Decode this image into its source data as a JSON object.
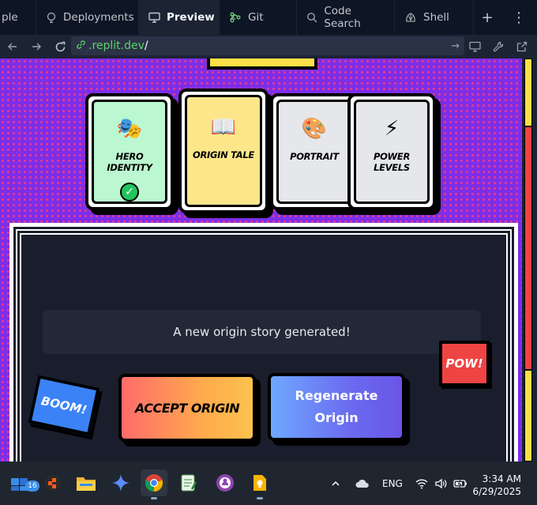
{
  "tabs": [
    {
      "label": "ple",
      "icon": "none"
    },
    {
      "label": "Deployments",
      "icon": "deploy-icon"
    },
    {
      "label": "Preview",
      "icon": "monitor-icon",
      "active": true
    },
    {
      "label": "Git",
      "icon": "git-icon"
    },
    {
      "label": "Code Search",
      "icon": "search-icon"
    },
    {
      "label": "Shell",
      "icon": "shell-icon"
    }
  ],
  "url": {
    "prefix": ".replit.dev",
    "suffix": "/"
  },
  "steps": [
    {
      "emoji": "🎭",
      "label": "HERO IDENTITY",
      "color": "#bbf7d0",
      "completed": true,
      "check": "✓"
    },
    {
      "emoji": "📖",
      "label": "ORIGIN TALE",
      "color": "#fde68a",
      "active": true
    },
    {
      "emoji": "🎨",
      "label": "PORTRAIT",
      "color": "#e5e7eb"
    },
    {
      "emoji": "⚡",
      "label": "POWER LEVELS",
      "color": "#e5e7eb"
    }
  ],
  "message": "A new origin story generated!",
  "buttons": {
    "accept": "ACCEPT ORIGIN",
    "regenerate": "Regenerate Origin"
  },
  "stickers": {
    "boom": "BOOM!",
    "pow": "POW!"
  },
  "taskbar": {
    "badge_count": "16",
    "language": "ENG",
    "time": "3:34 AM",
    "date": "6/29/2025"
  }
}
